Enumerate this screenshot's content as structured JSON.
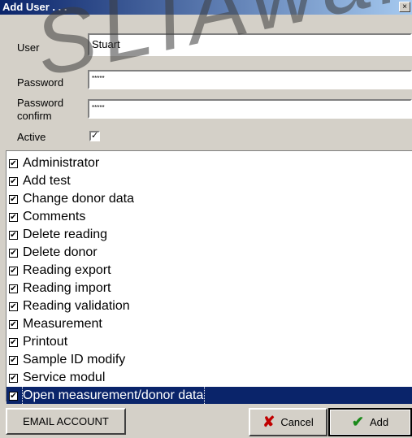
{
  "window": {
    "title": "Add User . . .",
    "close_glyph": "×"
  },
  "watermark": {
    "text": "SLIAwar"
  },
  "form": {
    "user_label": "User",
    "user_value": "Stuart",
    "password_label": "Password",
    "password_value": "*****",
    "password_confirm_label_line1": "Password",
    "password_confirm_label_line2": "confirm",
    "password_confirm_value": "*****",
    "active_label": "Active",
    "active_checked": true
  },
  "permissions": [
    {
      "label": "Administrator",
      "checked": true
    },
    {
      "label": "Add test",
      "checked": true
    },
    {
      "label": "Change donor data",
      "checked": true
    },
    {
      "label": "Comments",
      "checked": true
    },
    {
      "label": "Delete reading",
      "checked": true
    },
    {
      "label": "Delete donor",
      "checked": true
    },
    {
      "label": "Reading export",
      "checked": true
    },
    {
      "label": "Reading import",
      "checked": true
    },
    {
      "label": "Reading validation",
      "checked": true
    },
    {
      "label": "Measurement",
      "checked": true
    },
    {
      "label": "Printout",
      "checked": true
    },
    {
      "label": "Sample ID modify",
      "checked": true
    },
    {
      "label": "Service modul",
      "checked": true
    },
    {
      "label": "Open measurement/donor data",
      "checked": true,
      "selected": true
    }
  ],
  "buttons": {
    "email_account": "EMAIL ACCOUNT",
    "cancel": "Cancel",
    "add": "Add"
  },
  "icons": {
    "cancel": "x-icon",
    "add": "checkmark-icon",
    "cancel_color": "#c00000",
    "add_color": "#1a8a1a"
  }
}
